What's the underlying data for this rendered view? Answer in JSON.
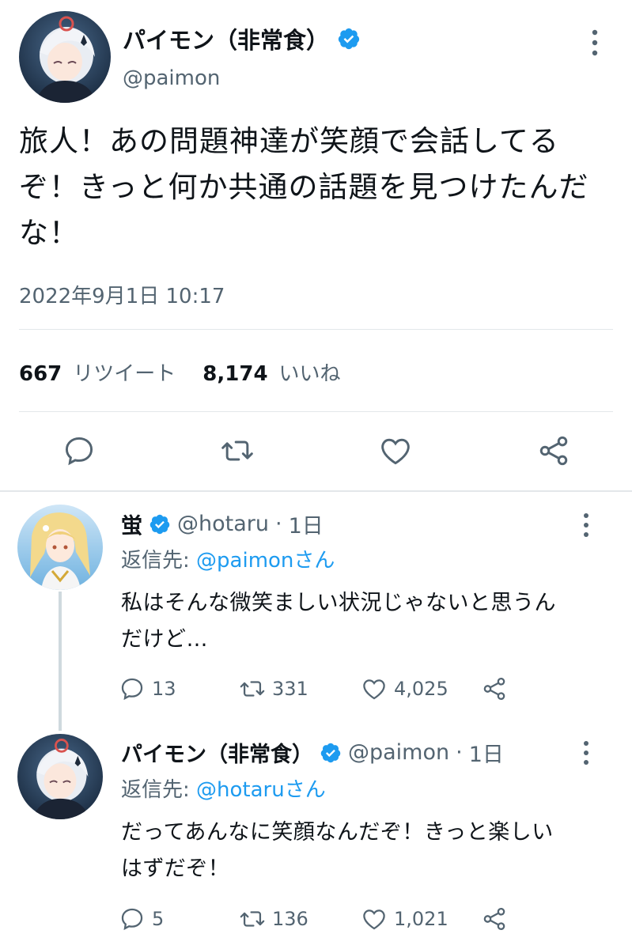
{
  "main_tweet": {
    "display_name": "パイモン（非常食）",
    "handle": "@paimon",
    "text": "旅人！あの問題神達が笑顔で会話してる\nぞ！きっと何か共通の話題を見つけたんだ\nな！",
    "timestamp": "2022年9月1日 10:17",
    "retweet_count": "667",
    "retweet_label": "リツイート",
    "like_count": "8,174",
    "like_label": "いいね",
    "actions": [
      "reply-icon",
      "retweet-icon",
      "like-icon",
      "share-icon"
    ]
  },
  "replies": [
    {
      "display_name": "蛍",
      "handle": "@hotaru",
      "time": "1日",
      "reply_to_label": "返信先: ",
      "reply_to_mention": "@paimonさん",
      "text": "私はそんな微笑ましい状況じゃないと思うん\nだけど…",
      "reply_count": "13",
      "retweet_count": "331",
      "like_count": "4,025"
    },
    {
      "display_name": "パイモン（非常食）",
      "handle": "@paimon",
      "time": "1日",
      "reply_to_label": "返信先: ",
      "reply_to_mention": "@hotaruさん",
      "text": "だってあんなに笑顔なんだぞ！きっと楽しい\nはずだぞ！",
      "reply_count": "5",
      "retweet_count": "136",
      "like_count": "1,021"
    }
  ],
  "separator": " · ",
  "colors": {
    "accent": "#1d9bf0",
    "text": "#0f1419",
    "muted": "#536471",
    "divider": "#e3e7ea",
    "thread_line": "#cfd9de"
  }
}
